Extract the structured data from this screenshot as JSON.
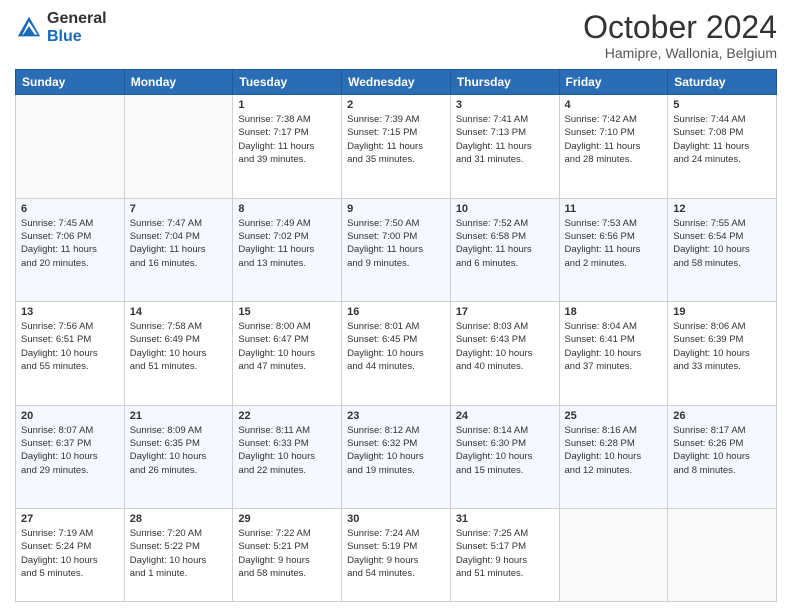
{
  "header": {
    "logo_general": "General",
    "logo_blue": "Blue",
    "month_title": "October 2024",
    "subtitle": "Hamipre, Wallonia, Belgium"
  },
  "weekdays": [
    "Sunday",
    "Monday",
    "Tuesday",
    "Wednesday",
    "Thursday",
    "Friday",
    "Saturday"
  ],
  "weeks": [
    [
      {
        "day": "",
        "content": ""
      },
      {
        "day": "",
        "content": ""
      },
      {
        "day": "1",
        "content": "Sunrise: 7:38 AM\nSunset: 7:17 PM\nDaylight: 11 hours\nand 39 minutes."
      },
      {
        "day": "2",
        "content": "Sunrise: 7:39 AM\nSunset: 7:15 PM\nDaylight: 11 hours\nand 35 minutes."
      },
      {
        "day": "3",
        "content": "Sunrise: 7:41 AM\nSunset: 7:13 PM\nDaylight: 11 hours\nand 31 minutes."
      },
      {
        "day": "4",
        "content": "Sunrise: 7:42 AM\nSunset: 7:10 PM\nDaylight: 11 hours\nand 28 minutes."
      },
      {
        "day": "5",
        "content": "Sunrise: 7:44 AM\nSunset: 7:08 PM\nDaylight: 11 hours\nand 24 minutes."
      }
    ],
    [
      {
        "day": "6",
        "content": "Sunrise: 7:45 AM\nSunset: 7:06 PM\nDaylight: 11 hours\nand 20 minutes."
      },
      {
        "day": "7",
        "content": "Sunrise: 7:47 AM\nSunset: 7:04 PM\nDaylight: 11 hours\nand 16 minutes."
      },
      {
        "day": "8",
        "content": "Sunrise: 7:49 AM\nSunset: 7:02 PM\nDaylight: 11 hours\nand 13 minutes."
      },
      {
        "day": "9",
        "content": "Sunrise: 7:50 AM\nSunset: 7:00 PM\nDaylight: 11 hours\nand 9 minutes."
      },
      {
        "day": "10",
        "content": "Sunrise: 7:52 AM\nSunset: 6:58 PM\nDaylight: 11 hours\nand 6 minutes."
      },
      {
        "day": "11",
        "content": "Sunrise: 7:53 AM\nSunset: 6:56 PM\nDaylight: 11 hours\nand 2 minutes."
      },
      {
        "day": "12",
        "content": "Sunrise: 7:55 AM\nSunset: 6:54 PM\nDaylight: 10 hours\nand 58 minutes."
      }
    ],
    [
      {
        "day": "13",
        "content": "Sunrise: 7:56 AM\nSunset: 6:51 PM\nDaylight: 10 hours\nand 55 minutes."
      },
      {
        "day": "14",
        "content": "Sunrise: 7:58 AM\nSunset: 6:49 PM\nDaylight: 10 hours\nand 51 minutes."
      },
      {
        "day": "15",
        "content": "Sunrise: 8:00 AM\nSunset: 6:47 PM\nDaylight: 10 hours\nand 47 minutes."
      },
      {
        "day": "16",
        "content": "Sunrise: 8:01 AM\nSunset: 6:45 PM\nDaylight: 10 hours\nand 44 minutes."
      },
      {
        "day": "17",
        "content": "Sunrise: 8:03 AM\nSunset: 6:43 PM\nDaylight: 10 hours\nand 40 minutes."
      },
      {
        "day": "18",
        "content": "Sunrise: 8:04 AM\nSunset: 6:41 PM\nDaylight: 10 hours\nand 37 minutes."
      },
      {
        "day": "19",
        "content": "Sunrise: 8:06 AM\nSunset: 6:39 PM\nDaylight: 10 hours\nand 33 minutes."
      }
    ],
    [
      {
        "day": "20",
        "content": "Sunrise: 8:07 AM\nSunset: 6:37 PM\nDaylight: 10 hours\nand 29 minutes."
      },
      {
        "day": "21",
        "content": "Sunrise: 8:09 AM\nSunset: 6:35 PM\nDaylight: 10 hours\nand 26 minutes."
      },
      {
        "day": "22",
        "content": "Sunrise: 8:11 AM\nSunset: 6:33 PM\nDaylight: 10 hours\nand 22 minutes."
      },
      {
        "day": "23",
        "content": "Sunrise: 8:12 AM\nSunset: 6:32 PM\nDaylight: 10 hours\nand 19 minutes."
      },
      {
        "day": "24",
        "content": "Sunrise: 8:14 AM\nSunset: 6:30 PM\nDaylight: 10 hours\nand 15 minutes."
      },
      {
        "day": "25",
        "content": "Sunrise: 8:16 AM\nSunset: 6:28 PM\nDaylight: 10 hours\nand 12 minutes."
      },
      {
        "day": "26",
        "content": "Sunrise: 8:17 AM\nSunset: 6:26 PM\nDaylight: 10 hours\nand 8 minutes."
      }
    ],
    [
      {
        "day": "27",
        "content": "Sunrise: 7:19 AM\nSunset: 5:24 PM\nDaylight: 10 hours\nand 5 minutes."
      },
      {
        "day": "28",
        "content": "Sunrise: 7:20 AM\nSunset: 5:22 PM\nDaylight: 10 hours\nand 1 minute."
      },
      {
        "day": "29",
        "content": "Sunrise: 7:22 AM\nSunset: 5:21 PM\nDaylight: 9 hours\nand 58 minutes."
      },
      {
        "day": "30",
        "content": "Sunrise: 7:24 AM\nSunset: 5:19 PM\nDaylight: 9 hours\nand 54 minutes."
      },
      {
        "day": "31",
        "content": "Sunrise: 7:25 AM\nSunset: 5:17 PM\nDaylight: 9 hours\nand 51 minutes."
      },
      {
        "day": "",
        "content": ""
      },
      {
        "day": "",
        "content": ""
      }
    ]
  ]
}
